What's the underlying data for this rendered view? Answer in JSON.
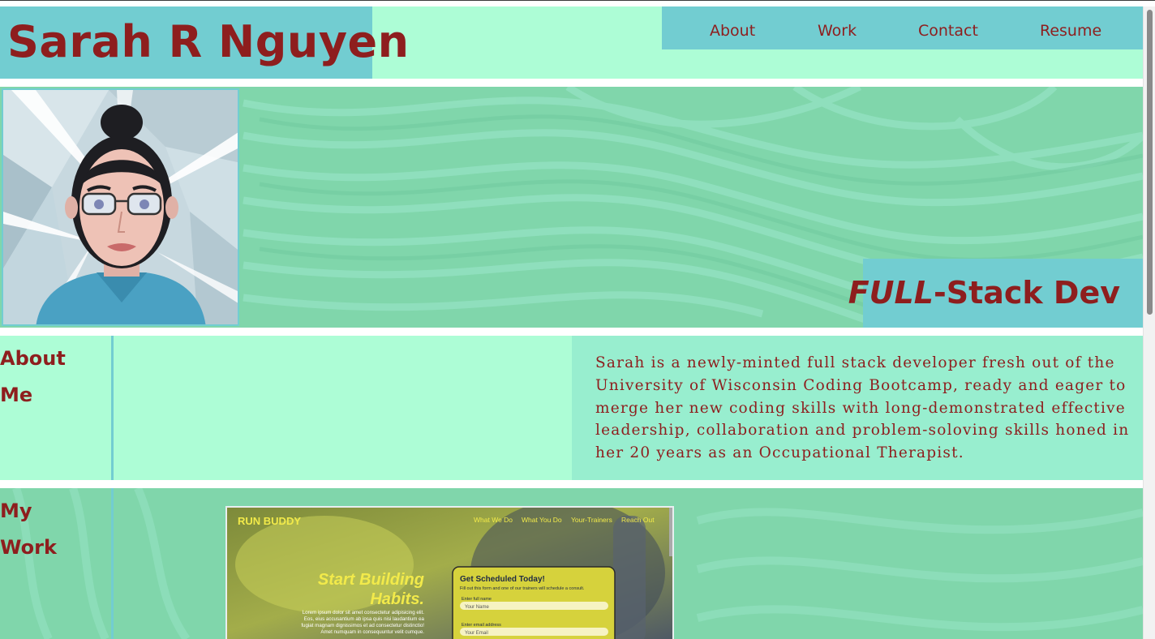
{
  "header": {
    "name": "Sarah R Nguyen",
    "nav": [
      "About",
      "Work",
      "Contact",
      "Resume"
    ]
  },
  "hero": {
    "tagline_emphasis": "FULL",
    "tagline_rest": "-Stack Dev"
  },
  "about": {
    "title_line1": "About",
    "title_line2": "Me",
    "text": "Sarah is a newly-minted full stack developer fresh out of the University of Wisconsin Coding Bootcamp, ready and eager to merge her new coding skills with long-demonstrated effective leadership, collaboration and problem-soloving skills honed in her 20 years as an Occupational Therapist."
  },
  "work": {
    "title_line1": "My",
    "title_line2": "Work",
    "project": {
      "logo": "RUN BUDDY",
      "nav": [
        "What We Do",
        "What You Do",
        "Your-Trainers",
        "Reach Out"
      ],
      "headline_line1": "Start Building",
      "headline_line2": "Habits.",
      "blurb_lines": [
        "Lorem ipsum dolor sit amet consectetur adipisicing elit.",
        "Eos, eius accusantium ab ipsa quis nisi laudantium ea",
        "fugiat magnam dignissimos et ad consectetur distinctio!",
        "Amet numquam in consequuntur velit cumque."
      ],
      "form_title": "Get Scheduled Today!",
      "form_subtitle": "Fill out this form and one of our trainers will schedule a consult.",
      "name_label": "Enter full name",
      "name_placeholder": "Your Name",
      "email_label": "Enter email address",
      "email_placeholder": "Your Email"
    }
  },
  "colors": {
    "accent_teal": "#72cdd1",
    "mint": "#adfdd6",
    "green": "#80d6ab",
    "text_maroon": "#8e1e1e"
  }
}
